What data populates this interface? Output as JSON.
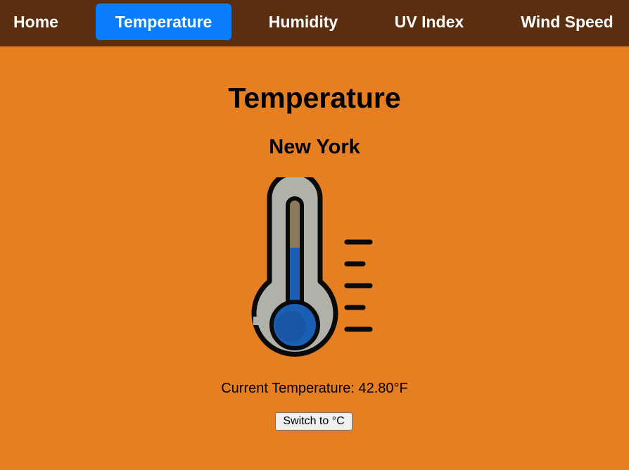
{
  "nav": {
    "items": [
      {
        "label": "Home"
      },
      {
        "label": "Temperature"
      },
      {
        "label": "Humidity"
      },
      {
        "label": "UV Index"
      },
      {
        "label": "Wind Speed"
      }
    ],
    "active_index": 1,
    "active_color": "#0a7dff",
    "background_color": "#5a2e0e"
  },
  "page": {
    "title": "Temperature",
    "background_color": "#e67e22"
  },
  "location": {
    "city": "New York"
  },
  "thermometer": {
    "icon": "thermometer-icon",
    "fill_color": "#1a5fb4"
  },
  "reading": {
    "text": "Current Temperature: 42.80°F"
  },
  "unit_toggle": {
    "label": "Switch to °C"
  }
}
